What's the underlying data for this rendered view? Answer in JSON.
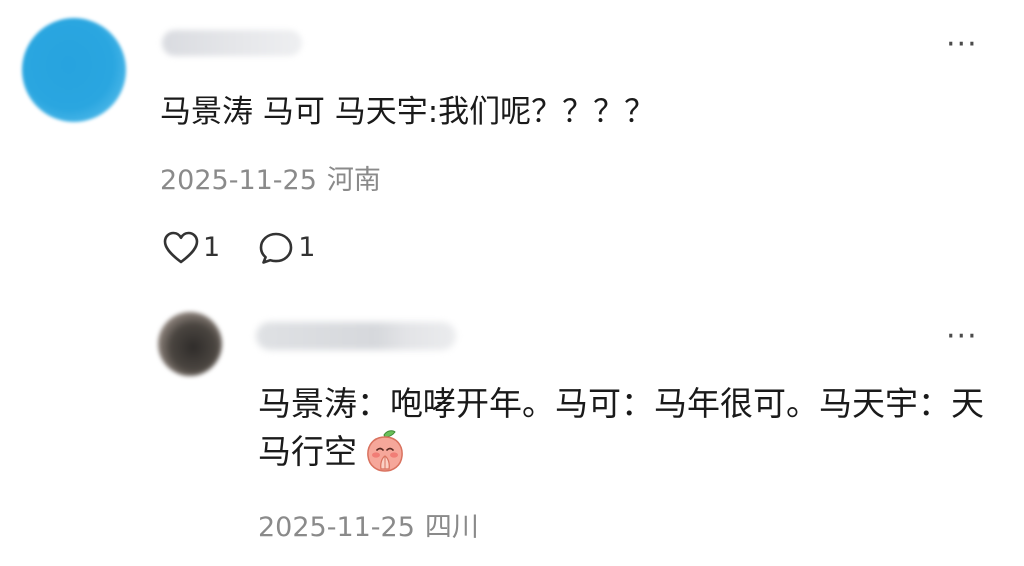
{
  "comment": {
    "username": "",
    "text": "马景涛 马可 马天宇:我们呢？？？？",
    "date": "2025-11-25",
    "location": "河南",
    "like_count": "1",
    "reply_count": "1",
    "more_label": "···",
    "icons": {
      "like": "heart-outline-icon",
      "reply": "speech-bubble-outline-icon",
      "more": "more-dots-icon"
    }
  },
  "reply": {
    "username": "",
    "text": "马景涛：咆哮开年。马可：马年很可。马天宇：天马行空",
    "emoji": "peach-praying-emoji",
    "date": "2025-11-25",
    "location": "四川",
    "more_label": "···"
  },
  "colors": {
    "main_avatar": "#2aa6e0",
    "meta_text": "#8a8a8a",
    "body_text": "#1a1a1a"
  }
}
